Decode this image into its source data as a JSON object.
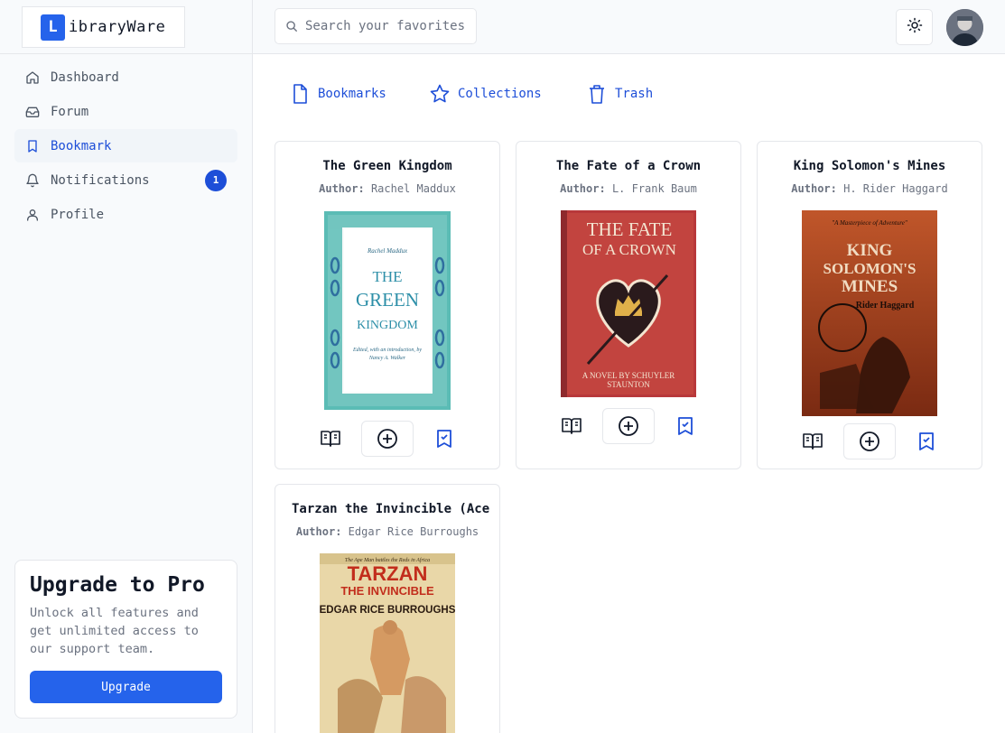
{
  "app": {
    "logo_letter": "L",
    "logo_text": "ibraryWare"
  },
  "sidebar": {
    "items": [
      {
        "label": "Dashboard",
        "icon": "home-icon"
      },
      {
        "label": "Forum",
        "icon": "inbox-icon"
      },
      {
        "label": "Bookmark",
        "icon": "bookmark-icon",
        "active": true
      },
      {
        "label": "Notifications",
        "icon": "bell-icon",
        "badge": "1"
      },
      {
        "label": "Profile",
        "icon": "user-icon"
      }
    ],
    "upgrade": {
      "title": "Upgrade to Pro",
      "text": "Unlock all features and get unlimited access to our support team.",
      "button": "Upgrade"
    }
  },
  "header": {
    "search_placeholder": "Search your favorites",
    "theme_icon": "sun-icon"
  },
  "tabs": [
    {
      "label": "Bookmarks",
      "icon": "file-icon"
    },
    {
      "label": "Collections",
      "icon": "star-icon"
    },
    {
      "label": "Trash",
      "icon": "trash-icon"
    }
  ],
  "books": [
    {
      "title": "The Green Kingdom",
      "author_label": "Author:",
      "author": "Rachel Maddux",
      "cover": {
        "title_lines": [
          "THE",
          "GREEN",
          "KINGDOM"
        ],
        "top_text": "Rachel Maddux",
        "bottom_text": "Edited, with an introduction, by Nancy A. Walker"
      }
    },
    {
      "title": "The Fate of a Crown",
      "author_label": "Author:",
      "author": "L. Frank Baum",
      "cover": {
        "title_lines": [
          "THE FATE",
          "OF A CROWN"
        ],
        "bottom_text": "A NOVEL BY SCHUYLER STAUNTON"
      }
    },
    {
      "title": "King Solomon's Mines",
      "author_label": "Author:",
      "author": "H. Rider Haggard",
      "cover": {
        "title_lines": [
          "KING",
          "SOLOMON'S",
          "MINES"
        ],
        "top_text": "\"A Masterpiece of Adventure\"",
        "author_text": "Rider Haggard"
      }
    },
    {
      "title": "Tarzan the Invincible (Ace",
      "author_label": "Author:",
      "author": "Edgar Rice Burroughs",
      "cover": {
        "title_lines": [
          "TARZAN",
          "THE INVINCIBLE"
        ],
        "top_text": "The Ape Man battles the Reds in Africa",
        "author_text": "EDGAR RICE BURROUGHS"
      }
    }
  ],
  "colors": {
    "accent": "#2563eb",
    "accent_text": "#1d4ed8",
    "border": "#e5e7eb",
    "sidebar_bg": "#f8fafc"
  }
}
